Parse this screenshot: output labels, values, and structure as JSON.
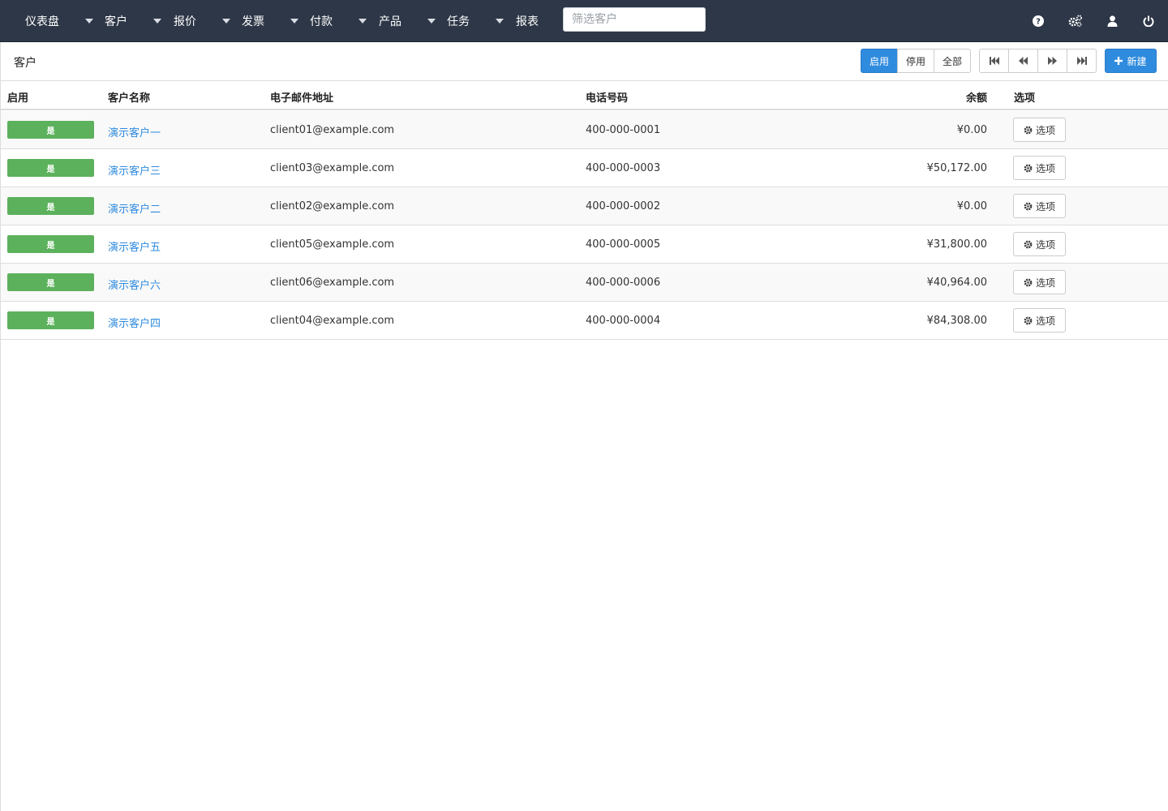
{
  "nav": {
    "dashboard": "仪表盘",
    "menus": [
      "客户",
      "报价",
      "发票",
      "付款",
      "产品",
      "任务",
      "报表"
    ],
    "search_placeholder": "筛选客户",
    "icons": [
      "help-icon",
      "settings-icon",
      "user-icon",
      "power-icon"
    ]
  },
  "header": {
    "title": "客户",
    "filters": [
      "启用",
      "停用",
      "全部"
    ],
    "active_filter": "启用",
    "new_label": "新建"
  },
  "table": {
    "columns": [
      "启用",
      "客户名称",
      "电子邮件地址",
      "电话号码",
      "余额",
      "选项"
    ],
    "rows": [
      {
        "active": "是",
        "name": "演示客户一",
        "email": "client01@example.com",
        "phone": "400-000-0001",
        "balance": "¥0.00",
        "options": "选项"
      },
      {
        "active": "是",
        "name": "演示客户三",
        "email": "client03@example.com",
        "phone": "400-000-0003",
        "balance": "¥50,172.00",
        "options": "选项"
      },
      {
        "active": "是",
        "name": "演示客户二",
        "email": "client02@example.com",
        "phone": "400-000-0002",
        "balance": "¥0.00",
        "options": "选项"
      },
      {
        "active": "是",
        "name": "演示客户五",
        "email": "client05@example.com",
        "phone": "400-000-0005",
        "balance": "¥31,800.00",
        "options": "选项"
      },
      {
        "active": "是",
        "name": "演示客户六",
        "email": "client06@example.com",
        "phone": "400-000-0006",
        "balance": "¥40,964.00",
        "options": "选项"
      },
      {
        "active": "是",
        "name": "演示客户四",
        "email": "client04@example.com",
        "phone": "400-000-0004",
        "balance": "¥84,308.00",
        "options": "选项"
      }
    ]
  },
  "colors": {
    "navbar": "#2e3747",
    "primary": "#2f8bde",
    "success": "#5cb15c"
  }
}
